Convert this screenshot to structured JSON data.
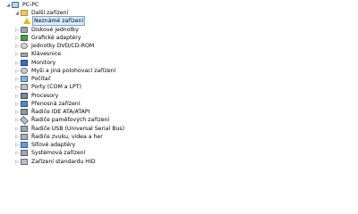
{
  "tree": {
    "root": {
      "label": "PC-PC",
      "expander": "◢",
      "icon": "computer-icon"
    },
    "items": [
      {
        "label": "Další zařízení",
        "expander": "◢",
        "icon": "unknown-device-folder-icon"
      },
      {
        "label": "Neznámé zařízení",
        "expander": "",
        "icon": "warning-icon",
        "selected": true
      },
      {
        "label": "Diskové jednotky",
        "expander": "▷",
        "icon": "disk-drive-icon"
      },
      {
        "label": "Grafické adaptéry",
        "expander": "▷",
        "icon": "display-adapter-icon"
      },
      {
        "label": "Jednotky DVD/CD-ROM",
        "expander": "▷",
        "icon": "dvd-drive-icon"
      },
      {
        "label": "Klávesnice",
        "expander": "▷",
        "icon": "keyboard-icon"
      },
      {
        "label": "Monitory",
        "expander": "▷",
        "icon": "monitor-icon"
      },
      {
        "label": "Myši a jiná polohovací zařízení",
        "expander": "▷",
        "icon": "mouse-icon"
      },
      {
        "label": "Počítač",
        "expander": "▷",
        "icon": "computer-icon"
      },
      {
        "label": "Porty (COM a LPT)",
        "expander": "▷",
        "icon": "port-icon"
      },
      {
        "label": "Procesory",
        "expander": "▷",
        "icon": "processor-icon"
      },
      {
        "label": "Přenosná zařízení",
        "expander": "▷",
        "icon": "portable-device-icon"
      },
      {
        "label": "Řadiče IDE ATA/ATAPI",
        "expander": "▷",
        "icon": "ide-controller-icon"
      },
      {
        "label": "Řadiče paměťových zařízení",
        "expander": "▷",
        "icon": "storage-controller-icon"
      },
      {
        "label": "Řadiče USB (Universal Serial Bus)",
        "expander": "▷",
        "icon": "usb-controller-icon"
      },
      {
        "label": "Řadiče zvuku, videa a her",
        "expander": "▷",
        "icon": "sound-controller-icon"
      },
      {
        "label": "Síťové adaptéry",
        "expander": "▷",
        "icon": "network-adapter-icon"
      },
      {
        "label": "Systémová zařízení",
        "expander": "▷",
        "icon": "system-device-icon"
      },
      {
        "label": "Zařízení standardu HID",
        "expander": "▷",
        "icon": "hid-device-icon"
      }
    ]
  }
}
